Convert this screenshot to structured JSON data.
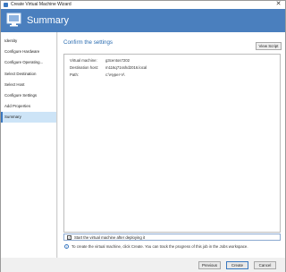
{
  "window": {
    "title": "Create Virtual Machine Wizard",
    "close_glyph": "✕"
  },
  "banner": {
    "title": "Summary"
  },
  "sidebar": {
    "items": [
      {
        "label": "Identity"
      },
      {
        "label": "Configure Hardware"
      },
      {
        "label": "Configure Operating..."
      },
      {
        "label": "Select Destination"
      },
      {
        "label": "Select Host"
      },
      {
        "label": "Configure Settings"
      },
      {
        "label": "Add Properties"
      },
      {
        "label": "Summary",
        "active": true
      }
    ]
  },
  "main": {
    "heading": "Confirm the settings",
    "view_script_label": "View Script",
    "summary": [
      {
        "label": "Virtual machine:",
        "value": "g3centos7202"
      },
      {
        "label": "Destination host:",
        "value": "m116q71sshd2016.local"
      },
      {
        "label": "Path:",
        "value": "c:\\Hyper-V\\"
      }
    ],
    "start_vm": {
      "label": "Start the virtual machine after deploying it",
      "checked": true
    },
    "info_text": "To create the virtual machine, click Create. You can track the progress of this job in the Jobs workspace."
  },
  "footer": {
    "previous_label": "Previous",
    "create_label": "Create",
    "cancel_label": "Cancel"
  },
  "colors": {
    "banner": "#4a7fbe",
    "accent": "#2b6cb0",
    "active_nav": "#cde4f7"
  },
  "icons": {
    "window": "wizard-icon",
    "banner": "virtual-machine-icon",
    "info": "info-icon"
  }
}
